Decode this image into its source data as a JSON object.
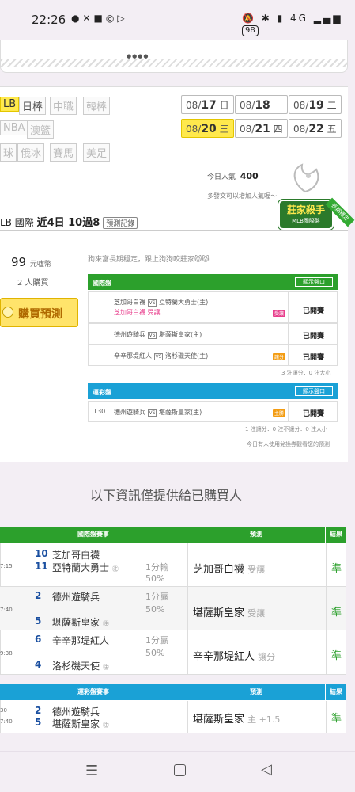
{
  "status_bar": {
    "time": "22:26",
    "battery": "98",
    "network": "4G"
  },
  "categories": {
    "row1": [
      "LB",
      "日棒",
      "中職",
      "韓棒"
    ],
    "row2": [
      "NBA",
      "澳籃"
    ],
    "row3": [
      "球",
      "俄冰",
      "賽馬",
      "美足"
    ]
  },
  "dates": [
    {
      "md": "08/",
      "d": "17",
      "w": "日"
    },
    {
      "md": "08/",
      "d": "18",
      "w": "一"
    },
    {
      "md": "08/",
      "d": "19",
      "w": "二"
    },
    {
      "md": "08/",
      "d": "20",
      "w": "三"
    },
    {
      "md": "08/",
      "d": "21",
      "w": "四"
    },
    {
      "md": "08/",
      "d": "22",
      "w": "五"
    }
  ],
  "popularity": {
    "label": "今日人氣",
    "value": "400",
    "hint": "多發文可以增加人氣喔～"
  },
  "header": {
    "league": "LB 國際",
    "streak": "近4日 10過8",
    "record_btn": "預測記錄"
  },
  "badge": {
    "title": "莊家殺手",
    "sub": "MLB國際盤",
    "ribbon": "長期穩定"
  },
  "purchase": {
    "price": "99",
    "unit": "元噓幣",
    "buyers": "2 人購買",
    "button": "購買預測"
  },
  "tip": "狗來富長期穩定，跟上狗狗咬莊家🐱🐱",
  "intl_section": {
    "title": "國際盤",
    "show_btn": "顯示盤口",
    "rows": [
      {
        "line1": "芝加哥白襪",
        "line1b": "亞特蘭大勇士(主)",
        "line2": "芝加哥白襪",
        "line2b": "受讓",
        "tag": "受讓",
        "status": "已開賽"
      },
      {
        "a": "德州遊騎兵",
        "b": "堪薩斯皇家(主)",
        "status": "已開賽"
      },
      {
        "a": "辛辛那堤紅人",
        "b": "洛杉磯天使(主)",
        "tag": "讓分",
        "status": "已開賽"
      }
    ],
    "summary": "3 注讓分．0 注大小"
  },
  "lottery_section": {
    "title": "運彩盤",
    "show_btn": "顯示盤口",
    "row": {
      "code": "130",
      "a": "德州遊騎兵",
      "b": "堪薩斯皇家(主)",
      "tag": "主勝",
      "status": "已開賽"
    },
    "summary": "1 注讓分．0 注不讓分．0 注大小",
    "footnote": "今日有人使用兌換券觀看您的預測"
  },
  "info_title": "以下資訊僅提供給已購買人",
  "table1": {
    "headers": [
      "國際盤賽事",
      "預測",
      "結果"
    ],
    "rows": [
      {
        "time": "7:15",
        "n1": "10",
        "t1": "芝加哥白襪",
        "n2": "11",
        "t2": "亞特蘭大勇士",
        "home": "㊟",
        "odds1": "1分輸",
        "odds2": "50%",
        "pred": "芝加哥白襪",
        "pred_tag": "受讓",
        "result": "準"
      },
      {
        "time": "7:40",
        "n1": "2",
        "t1": "德州遊騎兵",
        "n2": "5",
        "t2": "堪薩斯皇家",
        "home": "㊟",
        "odds1": "1分贏",
        "odds2": "50%",
        "pred": "堪薩斯皇家",
        "pred_tag": "受讓",
        "result": "準"
      },
      {
        "time": "9:38",
        "n1": "6",
        "t1": "辛辛那堤紅人",
        "n2": "4",
        "t2": "洛杉磯天使",
        "home": "㊟",
        "odds1": "1分贏",
        "odds2": "50%",
        "pred": "辛辛那堤紅人",
        "pred_tag": "讓分",
        "result": "準"
      }
    ]
  },
  "table2": {
    "headers": [
      "運彩盤賽事",
      "預測",
      "結果"
    ],
    "rows": [
      {
        "time1": "30",
        "time2": "7:40",
        "n1": "2",
        "t1": "德州遊騎兵",
        "n2": "5",
        "t2": "堪薩斯皇家",
        "home": "㊟",
        "pred": "堪薩斯皇家",
        "pred_tag": "主 +1.5",
        "result": "準"
      }
    ]
  },
  "colors": {
    "green": "#2ca02c",
    "blue": "#1aa1d6",
    "yellow": "#ffe94d"
  }
}
